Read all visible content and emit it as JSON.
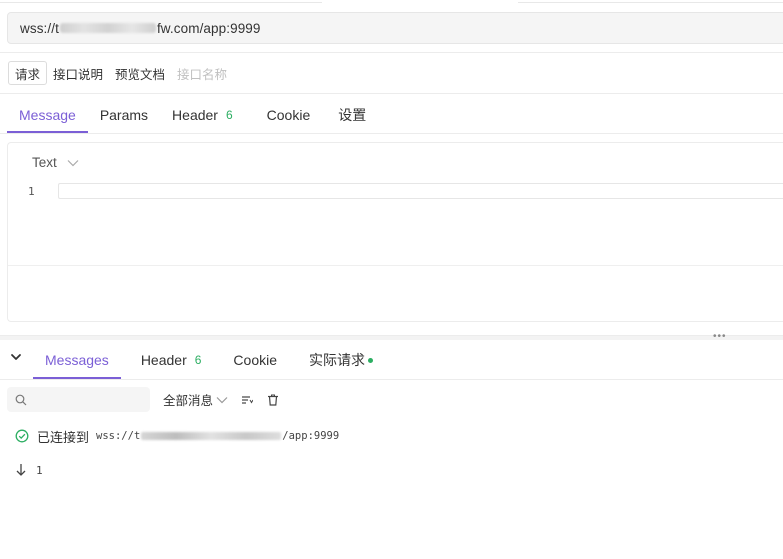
{
  "url_bar": {
    "prefix": "wss://t",
    "suffix": "fw.com/app:9999"
  },
  "mode_tabs": [
    {
      "label": "请求",
      "active": true
    },
    {
      "label": "接口说明",
      "active": false
    },
    {
      "label": "预览文档",
      "active": false
    },
    {
      "label": "接口名称",
      "active": false,
      "placeholder": true
    }
  ],
  "request_tabs": [
    {
      "label": "Message",
      "active": true
    },
    {
      "label": "Params"
    },
    {
      "label": "Header",
      "badge": "6"
    },
    {
      "label": "Cookie"
    },
    {
      "label": "设置"
    }
  ],
  "editor": {
    "format": "Text",
    "line_number": "1",
    "content": ""
  },
  "response_tabs": [
    {
      "label": "Messages",
      "active": true
    },
    {
      "label": "Header",
      "badge": "6"
    },
    {
      "label": "Cookie"
    },
    {
      "label": "实际请求",
      "status_dot": true
    }
  ],
  "filter": {
    "search_placeholder": "",
    "message_filter": "全部消息"
  },
  "messages": [
    {
      "type": "connected",
      "text": "已连接到",
      "url_prefix": "wss://t",
      "url_suffix": "/app:9999"
    },
    {
      "type": "received",
      "text": "1"
    }
  ],
  "colors": {
    "accent": "#7b5fd6",
    "success": "#2cae62"
  },
  "icons": [
    "chevron-down-icon",
    "search-icon",
    "sort-icon",
    "trash-icon",
    "check-circle-icon",
    "arrow-down-icon",
    "drag-handle-icon"
  ]
}
